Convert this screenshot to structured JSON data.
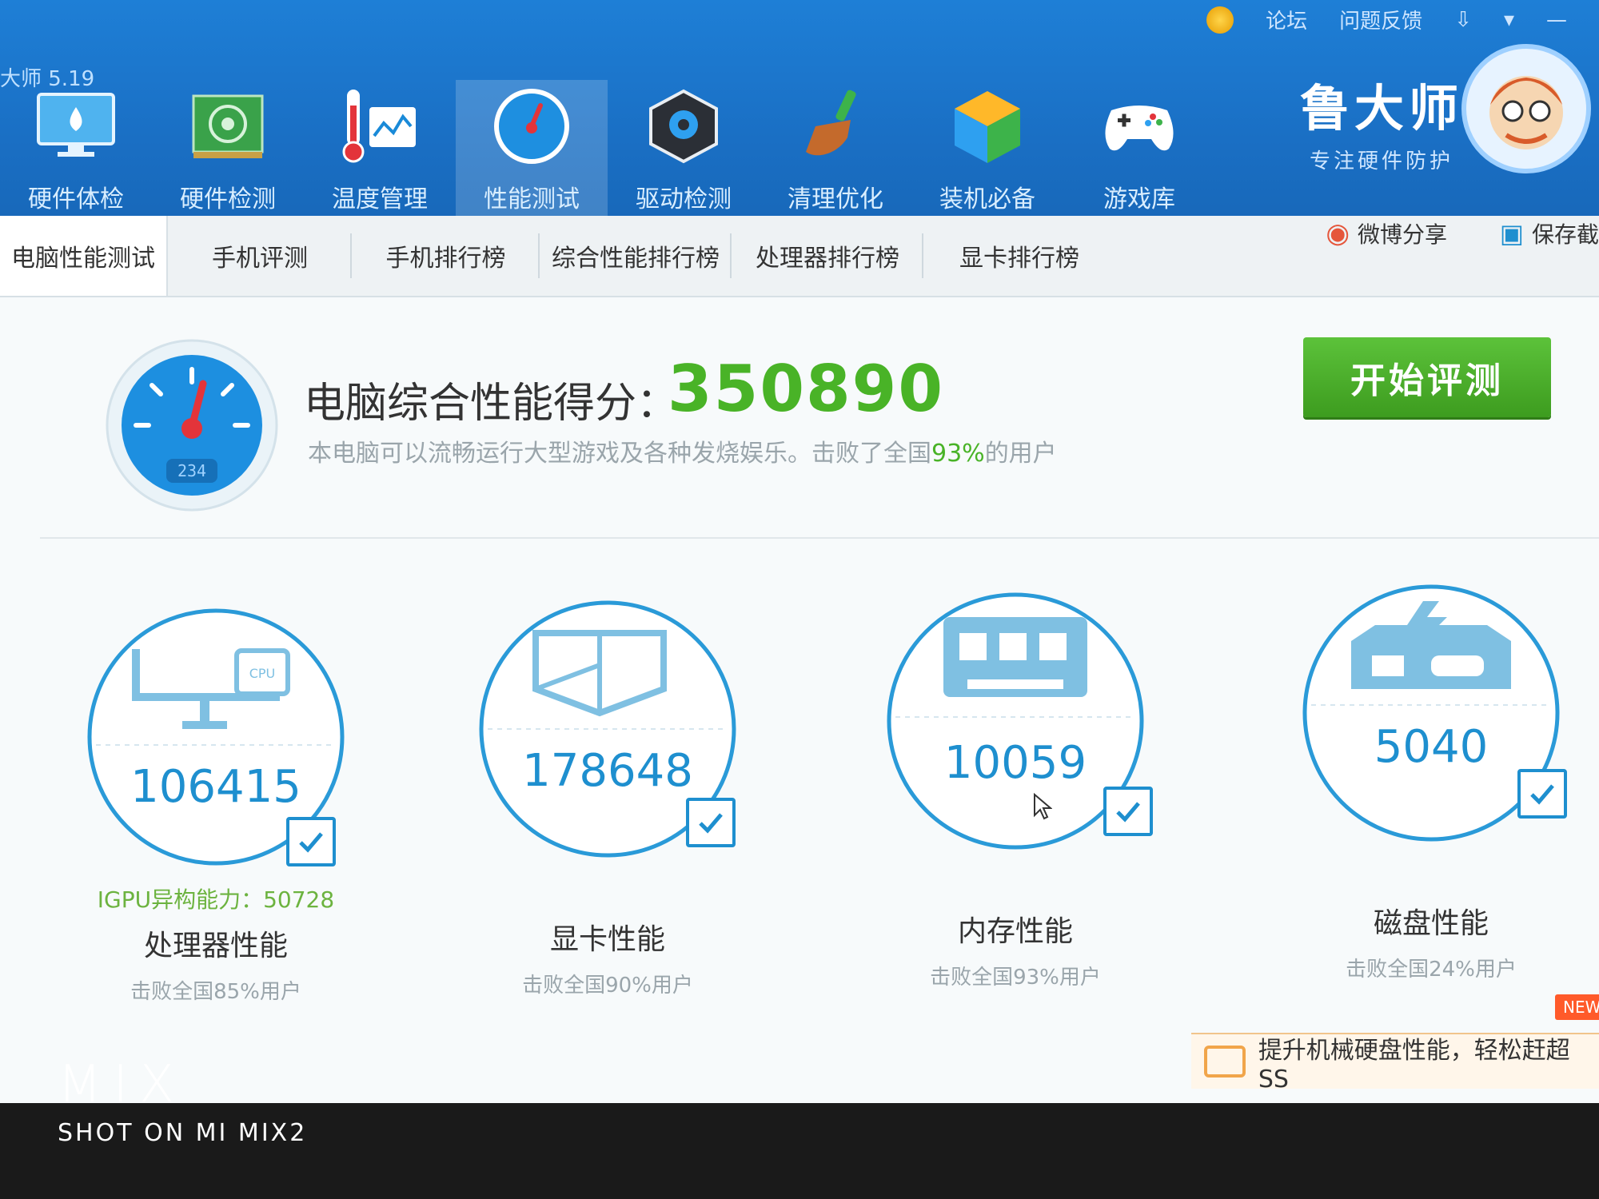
{
  "app": {
    "version": "大师 5.19"
  },
  "top_links": [
    "论坛",
    "问题反馈"
  ],
  "nav": [
    {
      "label": "硬件体检",
      "icon": "monitor-drop-icon"
    },
    {
      "label": "硬件检测",
      "icon": "circuit-board-icon"
    },
    {
      "label": "温度管理",
      "icon": "thermometer-icon"
    },
    {
      "label": "性能测试",
      "icon": "speedometer-icon"
    },
    {
      "label": "驱动检测",
      "icon": "driver-gear-icon"
    },
    {
      "label": "清理优化",
      "icon": "broom-icon"
    },
    {
      "label": "装机必备",
      "icon": "cube-icon"
    },
    {
      "label": "游戏库",
      "icon": "gamepad-icon"
    }
  ],
  "brand": {
    "name": "鲁大师",
    "slogan": "专注硬件防护"
  },
  "subtabs": [
    "电脑性能测试",
    "手机评测",
    "手机排行榜",
    "综合性能排行榜",
    "处理器排行榜",
    "显卡排行榜"
  ],
  "share": {
    "weibo": "微博分享",
    "save": "保存截"
  },
  "score": {
    "title": "电脑综合性能得分：",
    "value": "350890",
    "desc_prefix": "本电脑可以流畅运行大型游戏及各种发烧娱乐。击败了全国",
    "desc_pct": "93%",
    "desc_suffix": "的用户",
    "gauge_label": "234"
  },
  "start_button": "开始评测",
  "metrics": [
    {
      "value": "106415",
      "extra": "IGPU异构能力：50728",
      "name": "处理器性能",
      "beat": "击败全国85%用户",
      "icon": "cpu-monitor-icon"
    },
    {
      "value": "178648",
      "name": "显卡性能",
      "beat": "击败全国90%用户",
      "icon": "cube-wire-icon"
    },
    {
      "value": "10059",
      "name": "内存性能",
      "beat": "击败全国93%用户",
      "icon": "memory-chip-icon"
    },
    {
      "value": "5040",
      "name": "磁盘性能",
      "beat": "击败全国24%用户",
      "icon": "hard-disk-icon"
    }
  ],
  "promo": {
    "text": "提升机械硬盘性能，轻松赶超SS",
    "badge": "NEW"
  },
  "watermark": {
    "brand": "MIX",
    "shot": "SHOT ON MI MIX2"
  }
}
